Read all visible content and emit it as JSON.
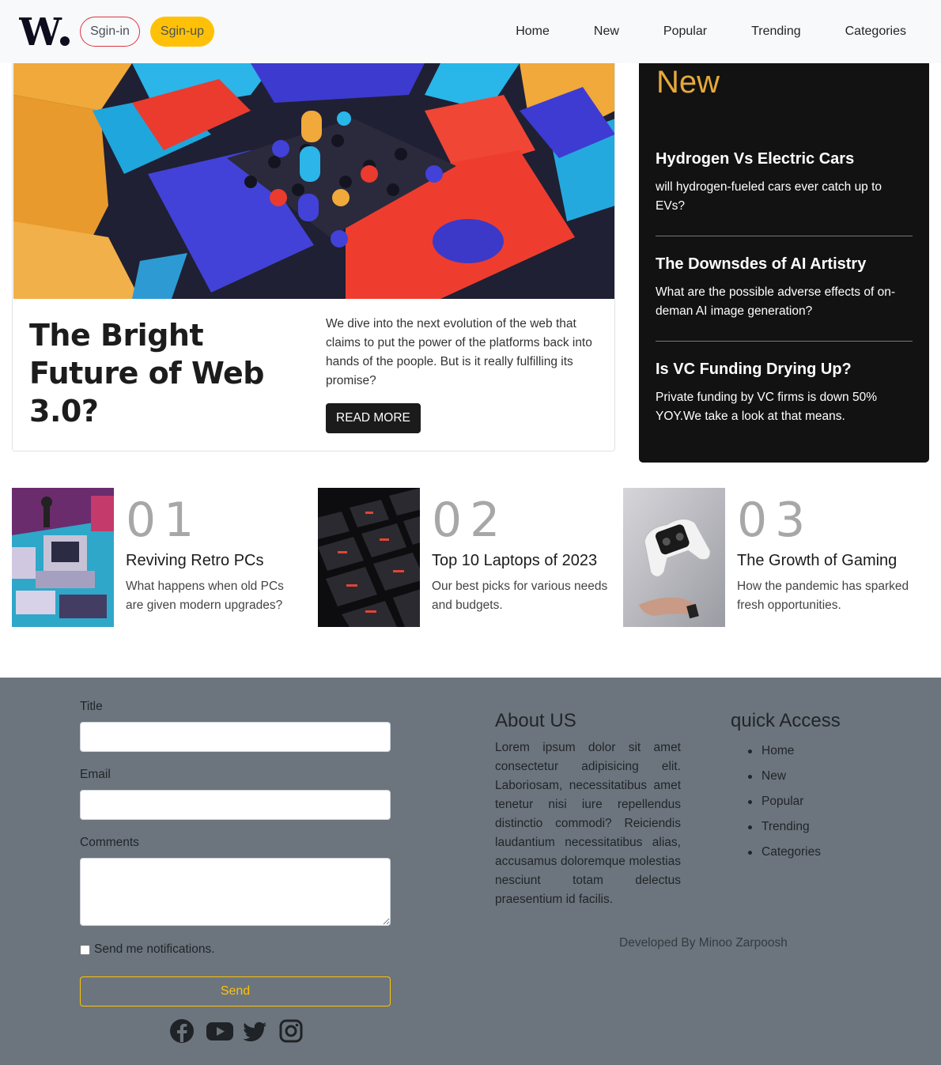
{
  "header": {
    "logo_text": "W.",
    "signin_label": "Sgin-in",
    "signup_label": "Sgin-up",
    "nav": [
      "Home",
      "New",
      "Popular",
      "Trending",
      "Categories"
    ]
  },
  "hero": {
    "title": "The Bright Future of Web 3.0?",
    "description": "We dive into the next evolution of the web that claims to put the power of the platforms back into hands of the poople. But is it really fulfilling its promise?",
    "read_more_label": "READ MORE"
  },
  "new_section": {
    "heading": "New",
    "items": [
      {
        "title": "Hydrogen Vs Electric Cars",
        "text": "will hydrogen-fueled cars ever catch up to EVs?"
      },
      {
        "title": "The Downsdes of AI Artistry",
        "text": "What are the possible adverse effects of on-deman AI image generation?"
      },
      {
        "title": "Is VC Funding Drying Up?",
        "text": "Private funding by VC firms is down 50% YOY.We take a look at that means."
      }
    ]
  },
  "articles": [
    {
      "number": "01",
      "title": "Reviving Retro PCs",
      "text": "What happens when old PCs are given modern upgrades?"
    },
    {
      "number": "02",
      "title": "Top 10 Laptops of 2023",
      "text": "Our best picks for various needs and budgets."
    },
    {
      "number": "03",
      "title": "The Growth of Gaming",
      "text": "How the pandemic has sparked fresh opportunities."
    }
  ],
  "footer": {
    "form": {
      "title_label": "Title",
      "email_label": "Email",
      "comments_label": "Comments",
      "notify_label": "Send me notifications.",
      "send_label": "Send"
    },
    "about": {
      "heading": "About US",
      "text": "Lorem ipsum dolor sit amet consectetur adipisicing elit. Laboriosam, necessitatibus amet tenetur nisi iure repellendus distinctio commodi? Reiciendis laudantium necessitatibus alias, accusamus doloremque molestias nesciunt totam delectus praesentium id facilis."
    },
    "quick_access": {
      "heading": "quick Access",
      "items": [
        "Home",
        "New",
        "Popular",
        "Trending",
        "Categories"
      ]
    },
    "developer": "Developed By Minoo Zarpoosh",
    "socials": [
      "facebook-icon",
      "youtube-icon",
      "twitter-icon",
      "instagram-icon"
    ]
  },
  "colors": {
    "accent_yellow": "#ffc107",
    "new_heading": "#e5a93a",
    "footer_bg": "#6c757d",
    "dark_box": "#121212"
  }
}
